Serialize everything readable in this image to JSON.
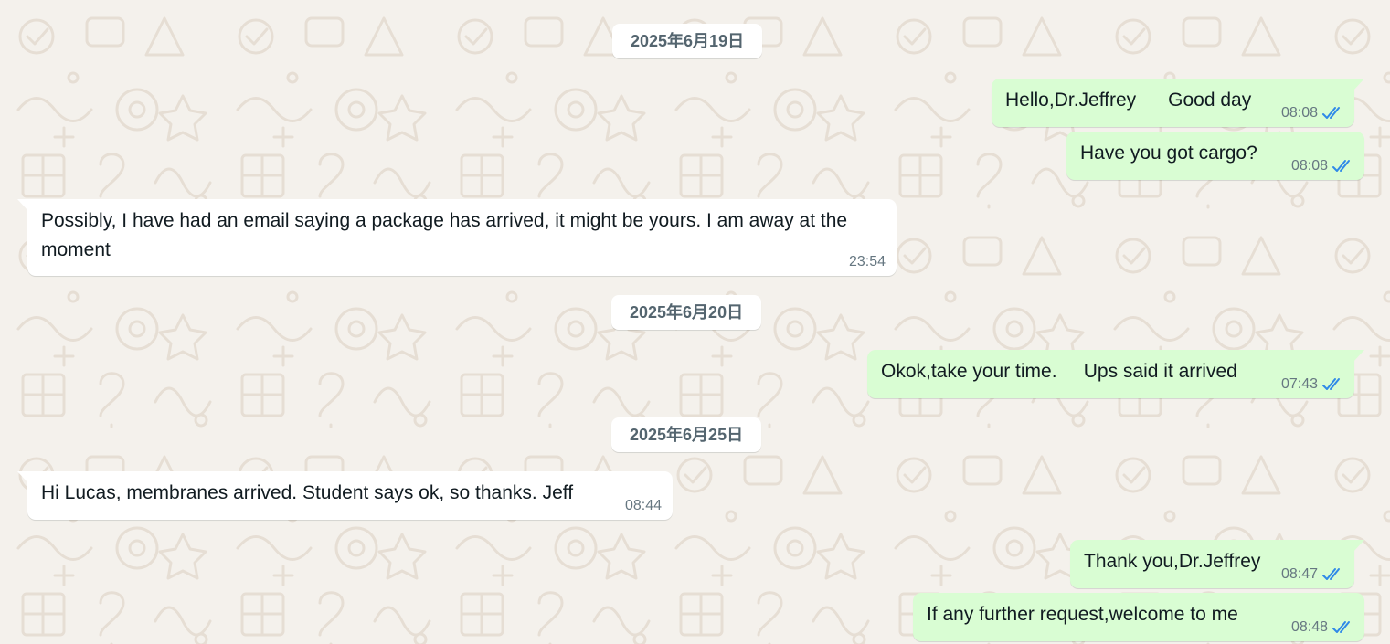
{
  "colors": {
    "background": "#f4f1ec",
    "outgoing_bubble": "#d9fdd3",
    "incoming_bubble": "#ffffff",
    "read_ticks": "#53bdeb",
    "timestamp": "#667781",
    "date_pill_text": "#54656f"
  },
  "dates": [
    {
      "label": "2025年6月19日"
    },
    {
      "label": "2025年6月20日"
    },
    {
      "label": "2025年6月25日"
    }
  ],
  "messages": [
    {
      "direction": "outgoing",
      "text": "Hello,Dr.Jeffrey      Good day",
      "time": "08:08",
      "status": "read",
      "status_icon": "double-check-icon"
    },
    {
      "direction": "outgoing",
      "text": "Have you got cargo?",
      "time": "08:08",
      "status": "read",
      "status_icon": "double-check-icon"
    },
    {
      "direction": "incoming",
      "text": "Possibly, I have had an email saying a package has arrived, it might be yours. I am away at the moment",
      "time": "23:54"
    },
    {
      "direction": "outgoing",
      "text": "Okok,take your time.     Ups said it arrived",
      "time": "07:43",
      "status": "read",
      "status_icon": "double-check-icon"
    },
    {
      "direction": "incoming",
      "text": "Hi Lucas, membranes arrived. Student says ok, so thanks. Jeff",
      "time": "08:44"
    },
    {
      "direction": "outgoing",
      "text": "Thank you,Dr.Jeffrey",
      "time": "08:47",
      "status": "read",
      "status_icon": "double-check-icon"
    },
    {
      "direction": "outgoing",
      "text": "If any further request,welcome to me",
      "time": "08:48",
      "status": "read",
      "status_icon": "double-check-icon"
    }
  ]
}
